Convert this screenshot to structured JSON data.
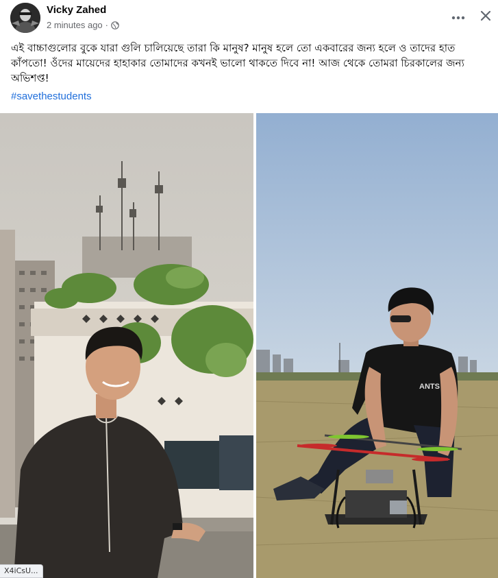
{
  "post": {
    "author": "Vicky Zahed",
    "timestamp": "2 minutes ago",
    "separator": "·",
    "audience_icon": "globe-icon",
    "body_text": "এই বাচ্চাগুলোর বুকে যারা গুলি চালিয়েছে তারা কি মানুষ? মানুষ হলে তো একবারের জন্য হলে ও তাদের হাত কাঁপতো!  ওঁদের মায়েদের হাহাকার তোমাদের কখনই ভালো থাকতে দিবে না! আজ থেকে তোমরা চিরকালের জন্য অভিশপ্ত!",
    "hashtag": "#savethestudents"
  },
  "actions": {
    "more_icon": "more-options-icon",
    "close_icon": "close-icon"
  },
  "photos": [
    {
      "subject": "young man in dark kurta smiling on rooftop with towers behind"
    },
    {
      "subject": "man in black t-shirt and sunglasses kneeling beside a drone in a field",
      "shirt_text": "ANTS"
    }
  ],
  "status_bar": {
    "url_preview": "X4iCsU..."
  }
}
